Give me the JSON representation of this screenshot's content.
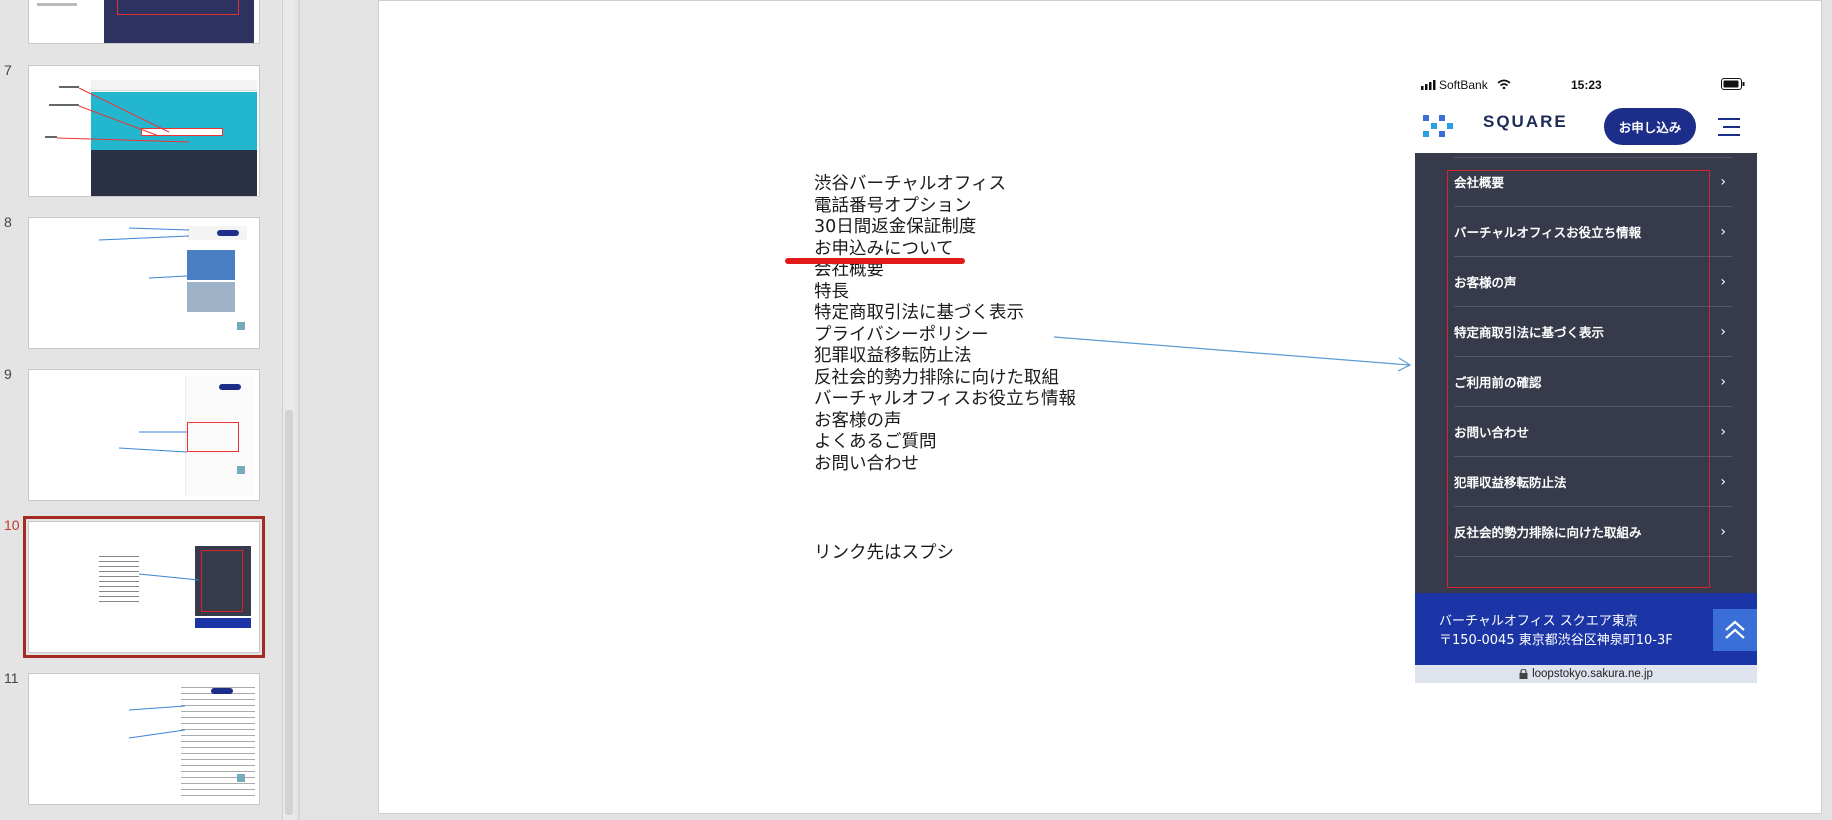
{
  "thumbnails": {
    "numbers": [
      "7",
      "8",
      "9",
      "10",
      "11"
    ]
  },
  "slide": {
    "menu_list": [
      "渋谷バーチャルオフィス",
      "電話番号オプション",
      "30日間返金保証制度",
      "お申込みについて",
      "会社概要",
      "特長",
      "特定商取引法に基づく表示",
      "プライバシーポリシー",
      "犯罪収益移転防止法",
      "反社会的勢力排除に向けた取組",
      "バーチャルオフィスお役立ち情報",
      "お客様の声",
      "よくあるご質問",
      "お問い合わせ"
    ],
    "link_note": "リンク先はスプシ"
  },
  "phone": {
    "status": {
      "carrier": "SoftBank",
      "time": "15:23"
    },
    "logo": "SQUARE",
    "apply_button": "お申し込み",
    "menu_items": [
      "会社概要",
      "バーチャルオフィスお役立ち情報",
      "お客様の声",
      "特定商取引法に基づく表示",
      "ご利用前の確認",
      "お問い合わせ",
      "犯罪収益移転防止法",
      "反社会的勢力排除に向けた取組み"
    ],
    "footer": {
      "name": "バーチャルオフィス スクエア東京",
      "address": "〒150-0045 東京都渋谷区神泉町10-3F"
    },
    "url": "loopstokyo.sakura.ne.jp"
  },
  "colors": {
    "accent_red": "#e21a1a",
    "menu_bg": "#363a4a",
    "brand_navy": "#1c2d8a",
    "footer_blue": "#1c35a6",
    "selected_thumb": "#a52a22"
  }
}
